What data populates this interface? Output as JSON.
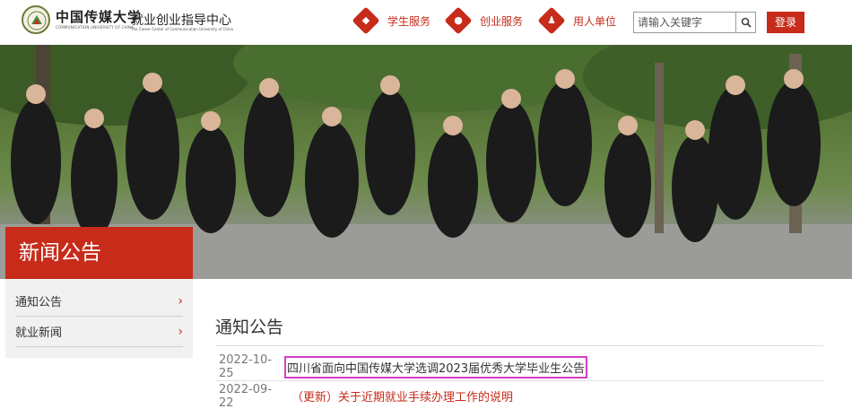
{
  "header": {
    "logo_cn": "中国传媒大学",
    "logo_en": "COMMUNICATION UNIVERSITY OF CHINA",
    "center_title": "就业创业指导中心",
    "center_subtitle": "The Career Center of Communication University of China",
    "nav": [
      {
        "label": "学生服务",
        "icon": "student-icon"
      },
      {
        "label": "创业服务",
        "icon": "person-icon"
      },
      {
        "label": "用人单位",
        "icon": "employer-icon"
      }
    ],
    "search_placeholder": "请输入关键字",
    "login_label": "登录"
  },
  "banner": {
    "section_label": "新闻公告"
  },
  "sidebar": {
    "items": [
      {
        "label": "通知公告"
      },
      {
        "label": "就业新闻"
      }
    ]
  },
  "main": {
    "section_title": "通知公告",
    "rows": [
      {
        "date": "2022-10-25",
        "title": "四川省面向中国传媒大学选调2023届优秀大学毕业生公告"
      },
      {
        "date": "2022-09-22",
        "title": "（更新）关于近期就业手续办理工作的说明"
      }
    ]
  },
  "colors": {
    "brand_red": "#c72b1a",
    "highlight_magenta": "#d53ec9"
  }
}
